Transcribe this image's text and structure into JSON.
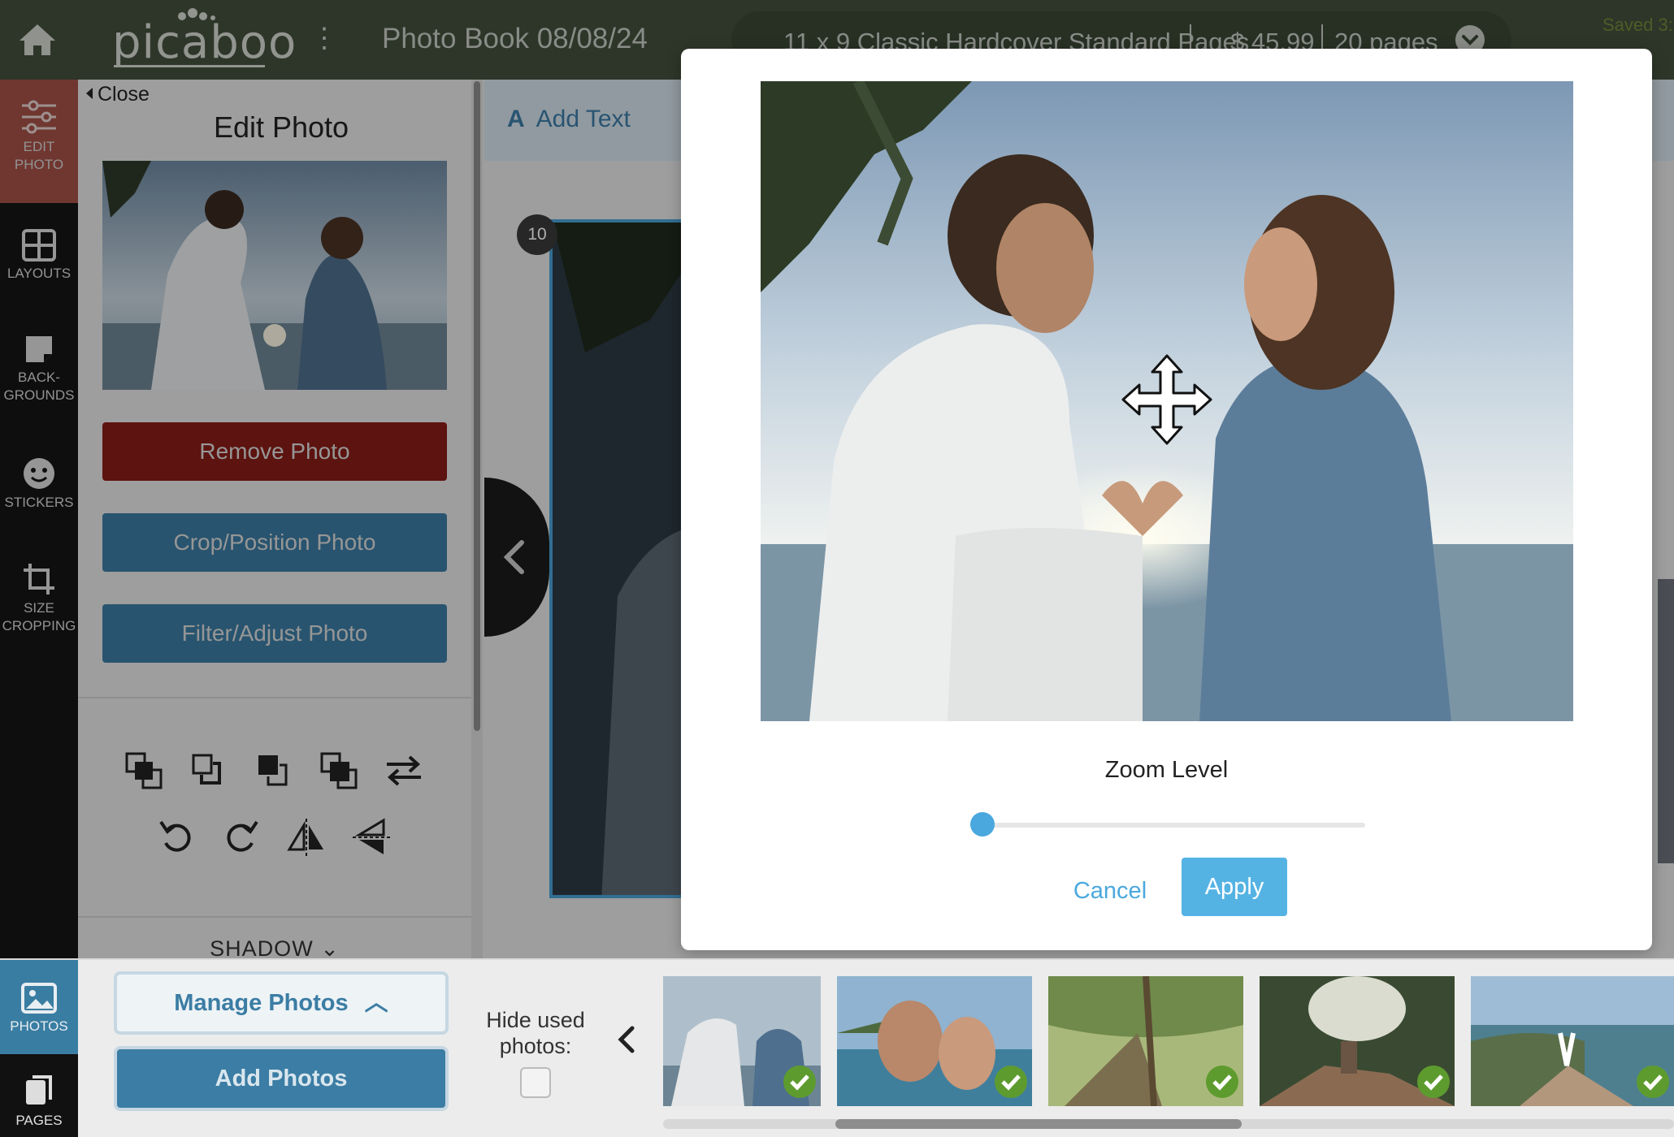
{
  "app": {
    "logo_text": "picaboo",
    "book_title": "Photo Book 08/08/24",
    "product": {
      "name": "11 x 9 Classic Hardcover Standard Pages",
      "price": "$ 45.99",
      "pages": "20 pages"
    },
    "saved_status": "Saved 3:"
  },
  "rail": {
    "items": [
      {
        "label_l1": "EDIT",
        "label_l2": "PHOTO",
        "icon": "sliders-icon"
      },
      {
        "label_l1": "LAYOUTS",
        "label_l2": "",
        "icon": "grid-icon"
      },
      {
        "label_l1": "BACK-",
        "label_l2": "GROUNDS",
        "icon": "background-icon"
      },
      {
        "label_l1": "STICKERS",
        "label_l2": "",
        "icon": "smiley-icon"
      },
      {
        "label_l1": "SIZE",
        "label_l2": "CROPPING",
        "icon": "crop-icon"
      }
    ],
    "photos_label": "PHOTOS",
    "pages_label": "PAGES"
  },
  "edit_panel": {
    "close_label": "Close",
    "title": "Edit Photo",
    "remove_label": "Remove Photo",
    "crop_label": "Crop/Position Photo",
    "filter_label": "Filter/Adjust Photo",
    "shadow_label": "SHADOW"
  },
  "canvas": {
    "add_text_label": "Add Text",
    "page_number": "10"
  },
  "modal": {
    "zoom_label": "Zoom Level",
    "zoom_value": 0,
    "cancel_label": "Cancel",
    "apply_label": "Apply"
  },
  "bottom": {
    "manage_label": "Manage Photos",
    "add_label": "Add Photos",
    "hide_used_label": "Hide used photos:",
    "hide_used_checked": false
  },
  "colors": {
    "topbar": "#44503d",
    "accent_blue": "#3b7da4",
    "remove_red": "#8a1c17",
    "used_check": "#5e9b2f"
  }
}
